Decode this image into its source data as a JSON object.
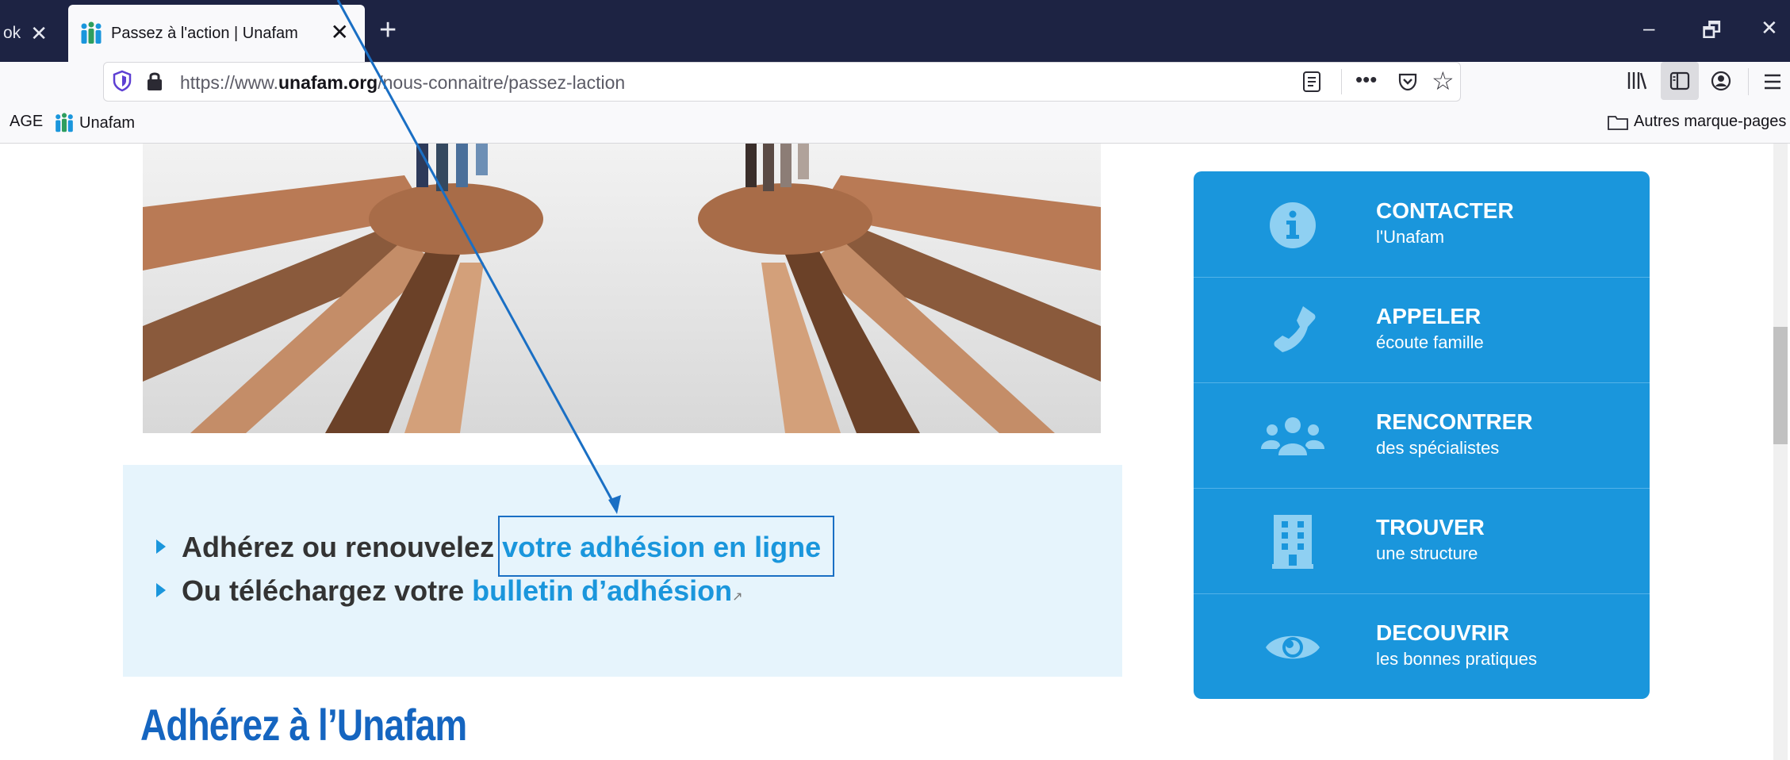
{
  "browser": {
    "prev_tab_title": "ok",
    "prev_tab_close": "✕",
    "active_tab_title": "Passez à l'action | Unafam",
    "active_tab_close": "✕",
    "new_tab": "+",
    "window_controls": {
      "minimize": "–",
      "restore": "🗗",
      "close": "✕"
    },
    "url_prefix": "https://www.",
    "url_domain": "unafam.org",
    "url_path": "/nous-connaitre/passez-laction",
    "url_icons": {
      "reader": "reader-view-icon",
      "more": "•••",
      "pocket": "pocket-icon",
      "star": "☆"
    },
    "toolbar_icons": [
      "library-icon",
      "sidebar-icon",
      "account-icon",
      "menu-icon"
    ],
    "bookmarks": {
      "left_cut": "AGE",
      "unafam": "Unafam",
      "other": "Autres marque-pages"
    }
  },
  "page": {
    "info_box": {
      "line1_text": "Adhérez ou renouvelez ",
      "line1_link": "votre adhésion en ligne",
      "line2_text": "Ou téléchargez votre ",
      "line2_link": "bulletin d’adhésion",
      "external_marker": "↗"
    },
    "heading": "Adhérez à l’Unafam",
    "sidebar_panel": [
      {
        "title": "CONTACTER",
        "subtitle": "l'Unafam",
        "icon": "info-icon"
      },
      {
        "title": "APPELER",
        "subtitle": "écoute famille",
        "icon": "phone-icon"
      },
      {
        "title": "RENCONTRER",
        "subtitle": "des spécialistes",
        "icon": "people-icon"
      },
      {
        "title": "TROUVER",
        "subtitle": "une structure",
        "icon": "building-icon"
      },
      {
        "title": "DECOUVRIR",
        "subtitle": "les bonnes pratiques",
        "icon": "eye-icon"
      }
    ]
  },
  "colors": {
    "tabbar": "#1d2343",
    "accent_blue": "#1a96dc",
    "heading_blue": "#1565c0",
    "info_bg": "#e6f4fc",
    "annotation": "#1a6fc4"
  }
}
